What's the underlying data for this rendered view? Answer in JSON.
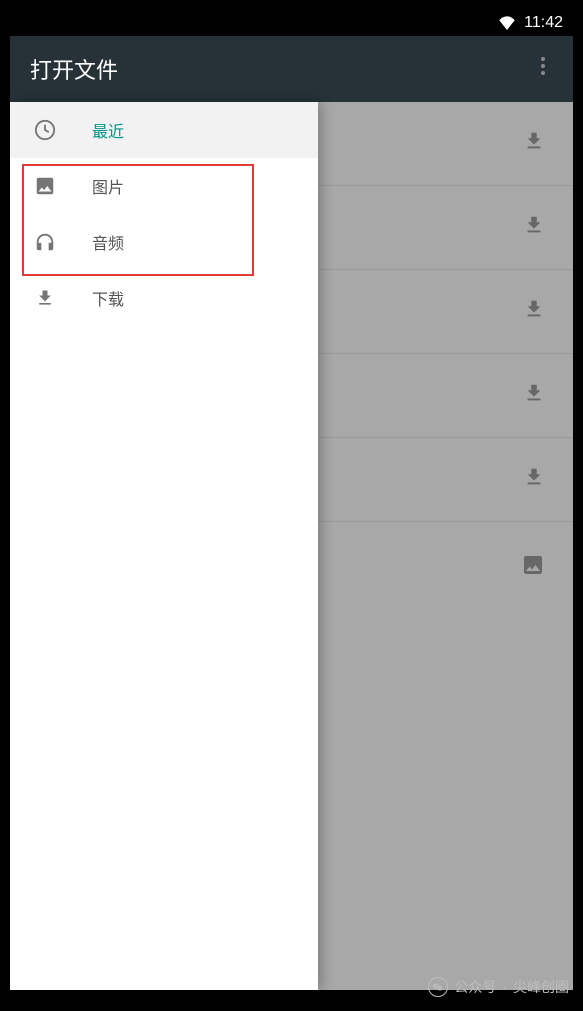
{
  "status_bar": {
    "time": "11:42"
  },
  "app_bar": {
    "title": "打开文件"
  },
  "drawer": {
    "items": [
      {
        "label": "最近",
        "icon": "clock-icon",
        "selected": true
      },
      {
        "label": "图片",
        "icon": "image-icon",
        "selected": false
      },
      {
        "label": "音频",
        "icon": "headphones-icon",
        "selected": false
      },
      {
        "label": "下载",
        "icon": "download-icon",
        "selected": false
      }
    ]
  },
  "background_rows": [
    {
      "icon": "download-icon"
    },
    {
      "icon": "download-icon"
    },
    {
      "icon": "download-icon"
    },
    {
      "icon": "download-icon"
    },
    {
      "icon": "download-icon"
    },
    {
      "icon": "image-icon"
    }
  ],
  "watermark": {
    "prefix": "公众号",
    "separator": "·",
    "name": "尖峰创圈"
  }
}
